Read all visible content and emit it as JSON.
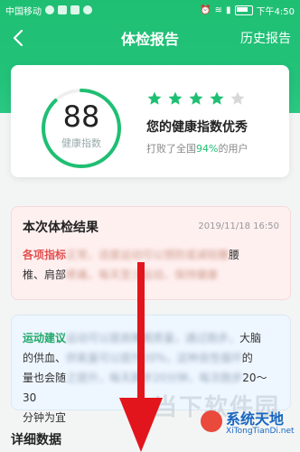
{
  "status_bar": {
    "carrier": "中国移动",
    "time": "下午4:50"
  },
  "nav": {
    "title": "体检报告",
    "history_label": "历史报告"
  },
  "score": {
    "value": "88",
    "label": "健康指数",
    "ring_progress": 0.88,
    "stars_filled": 4,
    "stars_total": 5,
    "rating_text": "您的健康指数优秀",
    "beat_prefix": "打败了全国",
    "beat_percent": "94%",
    "beat_suffix": "的用户"
  },
  "result": {
    "title": "本次体检结果",
    "date": "2019/11/18 16:50",
    "highlight": "各项指标",
    "line1_rest": "正常，适度运动可以预防或减轻腰",
    "line1_end": "腰",
    "line2_start": "椎、肩部",
    "line2_rest": "疼痛，每天至少运动，保持健康"
  },
  "advice": {
    "label": "运动建议",
    "line1_rest": "运动可以提高睡眠质量，通过跑步，",
    "line1_end": "大脑",
    "line2_start": "的供血、",
    "line2_rest": "供氧量可以提升20%，这种良性循环",
    "line2_end": "的",
    "line3_start": "量也会随",
    "line3_rest": "之提升，每天跑步20分钟，每次跑步",
    "line3_end": "20～30",
    "line4": "分钟为宜"
  },
  "detail": {
    "title": "详细数据"
  },
  "watermark": {
    "ghost_text": "当下软件园",
    "title": "系统天地",
    "url": "XiTongTianDi.net"
  },
  "colors": {
    "brand_green": "#1fbf73",
    "star_gray": "#d8d8d8",
    "arrow_red": "#e3151c"
  }
}
